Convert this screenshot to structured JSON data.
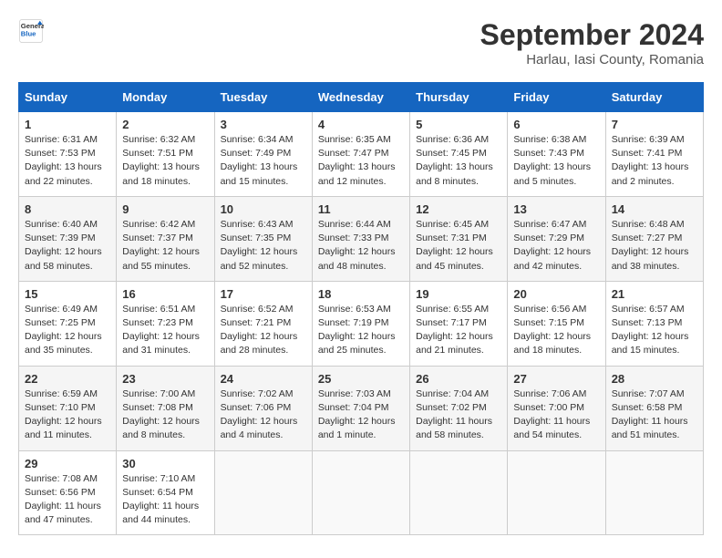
{
  "header": {
    "logo_line1": "General",
    "logo_line2": "Blue",
    "month_year": "September 2024",
    "location": "Harlau, Iasi County, Romania"
  },
  "weekdays": [
    "Sunday",
    "Monday",
    "Tuesday",
    "Wednesday",
    "Thursday",
    "Friday",
    "Saturday"
  ],
  "weeks": [
    [
      {
        "day": "1",
        "info": "Sunrise: 6:31 AM\nSunset: 7:53 PM\nDaylight: 13 hours\nand 22 minutes."
      },
      {
        "day": "2",
        "info": "Sunrise: 6:32 AM\nSunset: 7:51 PM\nDaylight: 13 hours\nand 18 minutes."
      },
      {
        "day": "3",
        "info": "Sunrise: 6:34 AM\nSunset: 7:49 PM\nDaylight: 13 hours\nand 15 minutes."
      },
      {
        "day": "4",
        "info": "Sunrise: 6:35 AM\nSunset: 7:47 PM\nDaylight: 13 hours\nand 12 minutes."
      },
      {
        "day": "5",
        "info": "Sunrise: 6:36 AM\nSunset: 7:45 PM\nDaylight: 13 hours\nand 8 minutes."
      },
      {
        "day": "6",
        "info": "Sunrise: 6:38 AM\nSunset: 7:43 PM\nDaylight: 13 hours\nand 5 minutes."
      },
      {
        "day": "7",
        "info": "Sunrise: 6:39 AM\nSunset: 7:41 PM\nDaylight: 13 hours\nand 2 minutes."
      }
    ],
    [
      {
        "day": "8",
        "info": "Sunrise: 6:40 AM\nSunset: 7:39 PM\nDaylight: 12 hours\nand 58 minutes."
      },
      {
        "day": "9",
        "info": "Sunrise: 6:42 AM\nSunset: 7:37 PM\nDaylight: 12 hours\nand 55 minutes."
      },
      {
        "day": "10",
        "info": "Sunrise: 6:43 AM\nSunset: 7:35 PM\nDaylight: 12 hours\nand 52 minutes."
      },
      {
        "day": "11",
        "info": "Sunrise: 6:44 AM\nSunset: 7:33 PM\nDaylight: 12 hours\nand 48 minutes."
      },
      {
        "day": "12",
        "info": "Sunrise: 6:45 AM\nSunset: 7:31 PM\nDaylight: 12 hours\nand 45 minutes."
      },
      {
        "day": "13",
        "info": "Sunrise: 6:47 AM\nSunset: 7:29 PM\nDaylight: 12 hours\nand 42 minutes."
      },
      {
        "day": "14",
        "info": "Sunrise: 6:48 AM\nSunset: 7:27 PM\nDaylight: 12 hours\nand 38 minutes."
      }
    ],
    [
      {
        "day": "15",
        "info": "Sunrise: 6:49 AM\nSunset: 7:25 PM\nDaylight: 12 hours\nand 35 minutes."
      },
      {
        "day": "16",
        "info": "Sunrise: 6:51 AM\nSunset: 7:23 PM\nDaylight: 12 hours\nand 31 minutes."
      },
      {
        "day": "17",
        "info": "Sunrise: 6:52 AM\nSunset: 7:21 PM\nDaylight: 12 hours\nand 28 minutes."
      },
      {
        "day": "18",
        "info": "Sunrise: 6:53 AM\nSunset: 7:19 PM\nDaylight: 12 hours\nand 25 minutes."
      },
      {
        "day": "19",
        "info": "Sunrise: 6:55 AM\nSunset: 7:17 PM\nDaylight: 12 hours\nand 21 minutes."
      },
      {
        "day": "20",
        "info": "Sunrise: 6:56 AM\nSunset: 7:15 PM\nDaylight: 12 hours\nand 18 minutes."
      },
      {
        "day": "21",
        "info": "Sunrise: 6:57 AM\nSunset: 7:13 PM\nDaylight: 12 hours\nand 15 minutes."
      }
    ],
    [
      {
        "day": "22",
        "info": "Sunrise: 6:59 AM\nSunset: 7:10 PM\nDaylight: 12 hours\nand 11 minutes."
      },
      {
        "day": "23",
        "info": "Sunrise: 7:00 AM\nSunset: 7:08 PM\nDaylight: 12 hours\nand 8 minutes."
      },
      {
        "day": "24",
        "info": "Sunrise: 7:02 AM\nSunset: 7:06 PM\nDaylight: 12 hours\nand 4 minutes."
      },
      {
        "day": "25",
        "info": "Sunrise: 7:03 AM\nSunset: 7:04 PM\nDaylight: 12 hours\nand 1 minute."
      },
      {
        "day": "26",
        "info": "Sunrise: 7:04 AM\nSunset: 7:02 PM\nDaylight: 11 hours\nand 58 minutes."
      },
      {
        "day": "27",
        "info": "Sunrise: 7:06 AM\nSunset: 7:00 PM\nDaylight: 11 hours\nand 54 minutes."
      },
      {
        "day": "28",
        "info": "Sunrise: 7:07 AM\nSunset: 6:58 PM\nDaylight: 11 hours\nand 51 minutes."
      }
    ],
    [
      {
        "day": "29",
        "info": "Sunrise: 7:08 AM\nSunset: 6:56 PM\nDaylight: 11 hours\nand 47 minutes."
      },
      {
        "day": "30",
        "info": "Sunrise: 7:10 AM\nSunset: 6:54 PM\nDaylight: 11 hours\nand 44 minutes."
      },
      {
        "day": "",
        "info": ""
      },
      {
        "day": "",
        "info": ""
      },
      {
        "day": "",
        "info": ""
      },
      {
        "day": "",
        "info": ""
      },
      {
        "day": "",
        "info": ""
      }
    ]
  ]
}
